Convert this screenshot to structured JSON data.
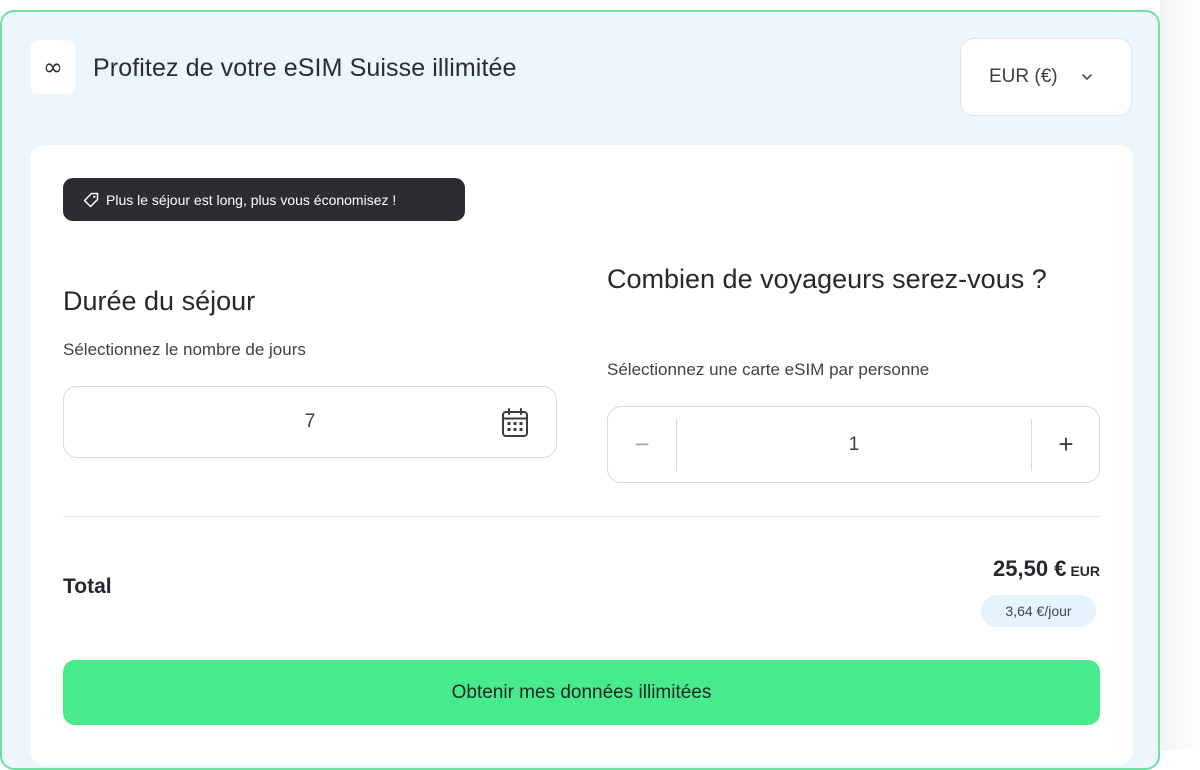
{
  "header": {
    "logo_symbol": "∞",
    "title": "Profitez de votre eSIM Suisse illimitée",
    "currency_label": "EUR (€)",
    "currency_icon": "chevron-down-icon"
  },
  "promo": {
    "icon": "tag-icon",
    "text": "Plus le séjour est long, plus vous économisez !"
  },
  "duration": {
    "title": "Durée du séjour",
    "subtitle": "Sélectionnez le nombre de jours",
    "value": "7",
    "icon": "calendar-icon"
  },
  "travelers": {
    "title": "Combien de voyageurs serez-vous ?",
    "subtitle": "Sélectionnez une carte eSIM par personne",
    "value": "1",
    "minus": "−",
    "plus": "+"
  },
  "summary": {
    "total_label": "Total",
    "amount": "25,50 €",
    "currency": "EUR",
    "per_day": "3,64 €/jour"
  },
  "cta": {
    "label": "Obtenir mes données illimitées"
  },
  "colors": {
    "panel_bg": "#ecf6fc",
    "panel_border": "#6fe0a0",
    "cta_bg": "#48eb8c",
    "promo_bg": "#2b2d30",
    "per_day_bg": "#e6f2fc"
  }
}
